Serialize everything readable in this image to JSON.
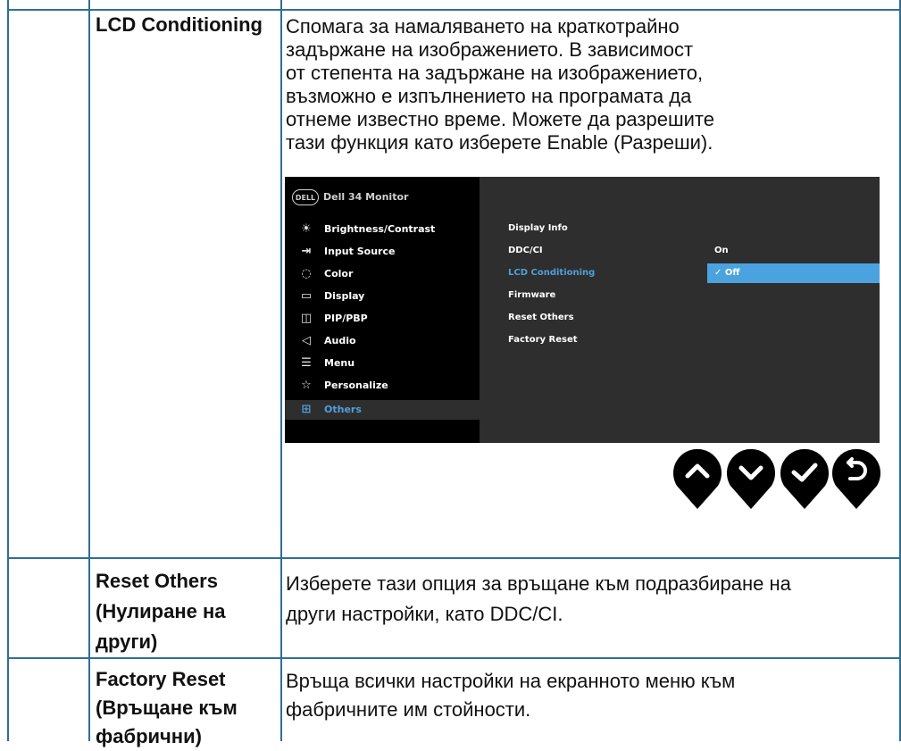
{
  "rows": [
    {
      "label": "LCD Conditioning",
      "description_lines": [
        "Спомага за намаляването на краткотрайно",
        "задържане на изображението. В зависимост",
        "от степента на задържане на изображението,",
        "възможно е изпълнението на програмата да",
        "отнеме известно време. Можете да разрешите",
        "тази функция като изберете Enable (Разреши)."
      ]
    },
    {
      "label_lines": [
        "Reset Others",
        "(Нулиране на",
        "други)"
      ],
      "description_lines": [
        "Изберете тази опция за връщане към подразбиране на",
        "други настройки, като DDC/CI."
      ]
    },
    {
      "label_lines": [
        "Factory Reset",
        "(Връщане към",
        "фабрични)"
      ],
      "description_lines": [
        "Връща всички настройки на екранното меню към",
        "фабричните им стойности."
      ]
    }
  ],
  "osd": {
    "logo": "DELL",
    "title": "Dell 34 Monitor",
    "menu": [
      {
        "label": "Brightness/Contrast",
        "icon": "brightness-icon"
      },
      {
        "label": "Input Source",
        "icon": "input-source-icon"
      },
      {
        "label": "Color",
        "icon": "color-icon"
      },
      {
        "label": "Display",
        "icon": "display-icon"
      },
      {
        "label": "PIP/PBP",
        "icon": "pip-pbp-icon"
      },
      {
        "label": "Audio",
        "icon": "audio-icon"
      },
      {
        "label": "Menu",
        "icon": "menu-icon"
      },
      {
        "label": "Personalize",
        "icon": "star-icon"
      },
      {
        "label": "Others",
        "icon": "others-icon",
        "selected": true
      }
    ],
    "submenu": [
      {
        "label": "Display Info"
      },
      {
        "label": "DDC/CI"
      },
      {
        "label": "LCD Conditioning",
        "active": true
      },
      {
        "label": "Firmware"
      },
      {
        "label": "Reset Others"
      },
      {
        "label": "Factory Reset"
      }
    ],
    "options": [
      {
        "label": "On"
      },
      {
        "label": "✓ Off",
        "selected": true
      }
    ],
    "nav_buttons": [
      "up-button",
      "down-button",
      "confirm-button",
      "back-button"
    ],
    "colors": {
      "accent": "#4aa3df",
      "highlight_text": "#4f9fd9",
      "panel": "#2e2e2e"
    }
  }
}
